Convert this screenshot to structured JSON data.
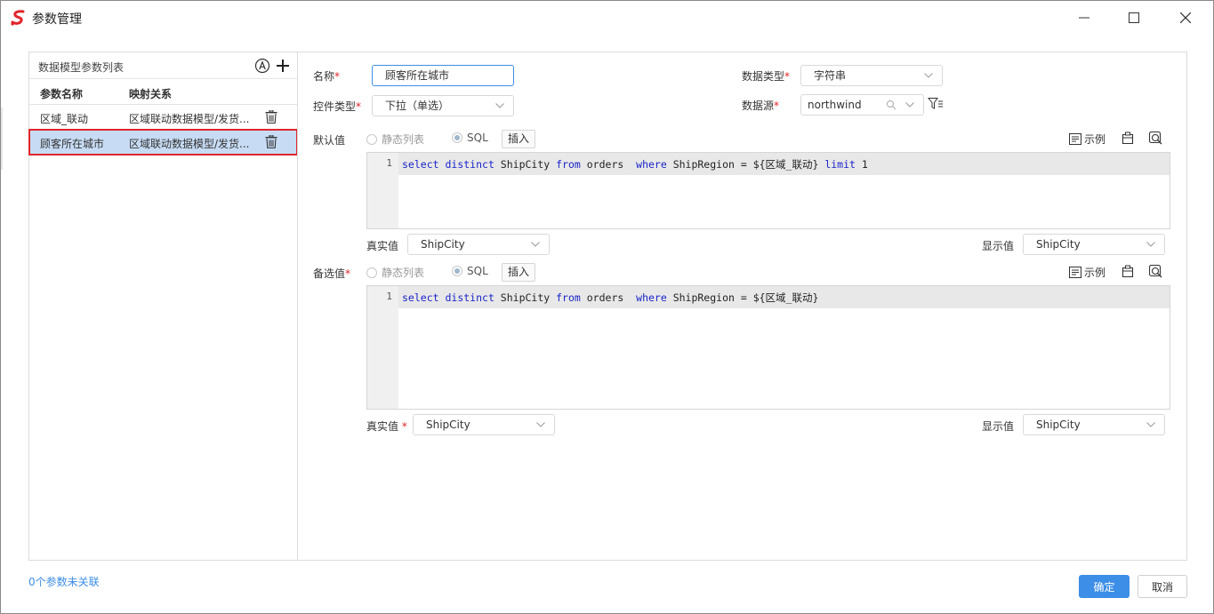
{
  "window": {
    "title": "参数管理"
  },
  "left": {
    "title": "数据模型参数列表",
    "columns": [
      "参数名称",
      "映射关系"
    ],
    "rows": [
      {
        "name": "区域_联动",
        "mapping": "区域联动数据模型/发货..."
      },
      {
        "name": "顾客所在城市",
        "mapping": "区域联动数据模型/发货..."
      }
    ]
  },
  "form": {
    "name_label": "名称",
    "name_value": "顾客所在城市",
    "data_type_label": "数据类型",
    "data_type_value": "字符串",
    "control_type_label": "控件类型",
    "control_type_value": "下拉（单选）",
    "data_source_label": "数据源",
    "data_source_value": "northwind",
    "required_mark": "*",
    "default": {
      "label": "默认值",
      "radio_static": "静态列表",
      "radio_sql": "SQL",
      "insert": "插入",
      "example": "示例",
      "line_no": "1",
      "sql_parts": [
        "select",
        " ",
        "distinct",
        " ShipCity ",
        "from",
        " orders  ",
        "where",
        " ShipRegion = ${区域_联动} ",
        "limit",
        " 1"
      ],
      "real_label": "真实值",
      "real_value": "ShipCity",
      "display_label": "显示值",
      "display_value": "ShipCity"
    },
    "options": {
      "label": "备选值",
      "radio_static": "静态列表",
      "radio_sql": "SQL",
      "insert": "插入",
      "example": "示例",
      "line_no": "1",
      "sql_parts": [
        "select",
        " ",
        "distinct",
        " ShipCity ",
        "from",
        " orders  ",
        "where",
        " ShipRegion = ${区域_联动}"
      ],
      "real_label": "真实值",
      "real_value": "ShipCity",
      "display_label": "显示值",
      "display_value": "ShipCity"
    }
  },
  "footer": {
    "unlinked": "0个参数未关联",
    "ok": "确定",
    "cancel": "取消"
  },
  "colors": {
    "accent": "#3d8ee6",
    "selected_row": "#c7dcf4",
    "highlight_border": "#e0252b",
    "keyword": "#1a24c8"
  }
}
